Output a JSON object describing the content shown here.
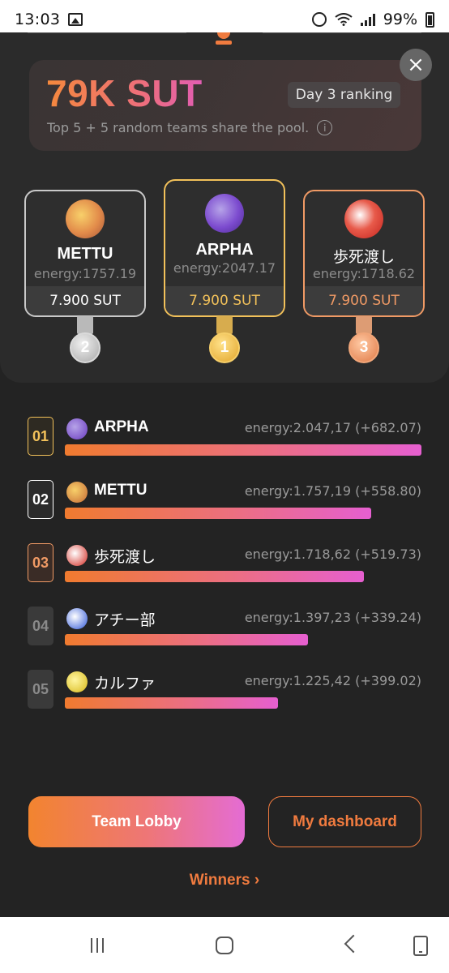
{
  "status_bar": {
    "time": "13:03",
    "battery": "99%",
    "icons": [
      "image-icon",
      "alarm-icon",
      "wifi-icon",
      "signal-icon",
      "battery-icon"
    ]
  },
  "pool": {
    "amount": "79K SUT",
    "day_badge": "Day 3 ranking",
    "description": "Top 5 + 5 random teams share the pool.",
    "info_glyph": "i"
  },
  "close_glyph": "×",
  "podium": [
    {
      "place": "2",
      "name": "METTU",
      "energy": "energy:1757.19",
      "prize": "7.900 SUT"
    },
    {
      "place": "1",
      "name": "ARPHA",
      "energy": "energy:2047.17",
      "prize": "7.900 SUT"
    },
    {
      "place": "3",
      "name": "歩死渡し",
      "energy": "energy:1718.62",
      "prize": "7.900 SUT"
    }
  ],
  "ranking": [
    {
      "rank": "01",
      "name": "ARPHA",
      "energy": "energy:2.047,17 (+682.07)",
      "progress": 1.0
    },
    {
      "rank": "02",
      "name": "METTU",
      "energy": "energy:1.757,19 (+558.80)",
      "progress": 0.858
    },
    {
      "rank": "03",
      "name": "歩死渡し",
      "energy": "energy:1.718,62 (+519.73)",
      "progress": 0.839
    },
    {
      "rank": "04",
      "name": "アチー部",
      "energy": "energy:1.397,23 (+339.24)",
      "progress": 0.682
    },
    {
      "rank": "05",
      "name": "カルファ",
      "energy": "energy:1.225,42 (+399.02)",
      "progress": 0.598
    }
  ],
  "buttons": {
    "team_lobby": "Team Lobby",
    "my_dashboard": "My dashboard",
    "winners": "Winners ›"
  },
  "colors": {
    "accent_orange": "#f07b3f",
    "gold": "#f2c15a",
    "silver": "#c9c9c9",
    "bronze": "#f09a65",
    "background": "#232323"
  }
}
